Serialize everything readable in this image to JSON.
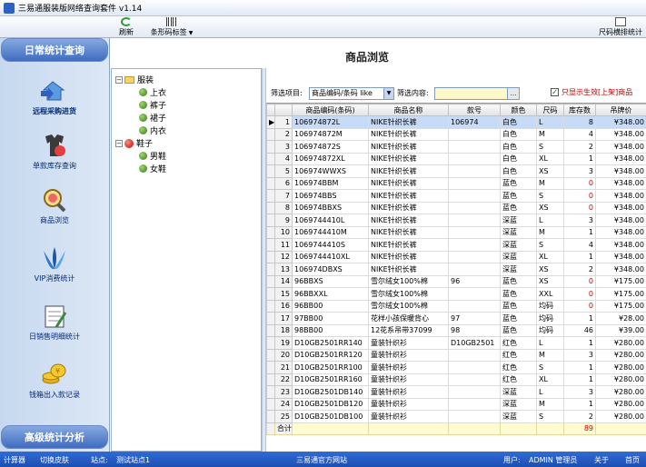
{
  "window": {
    "title": "三易通服装版网络查询套件 v1.14"
  },
  "toolbar": {
    "refresh_label": "刷新",
    "barcode_label": "条形码标签",
    "report_label": "尺码横排统计"
  },
  "sidebar": {
    "header_top": "日常统计查询",
    "header_bottom": "高级统计分析",
    "items": [
      {
        "label": "远程采购进货",
        "icon": "house-arrow-icon"
      },
      {
        "label": "单款库存查询",
        "icon": "clothes-icon"
      },
      {
        "label": "商品浏览",
        "icon": "magnifier-icon"
      },
      {
        "label": "VIP消费统计",
        "icon": "vip-icon"
      },
      {
        "label": "日销售明细统计",
        "icon": "notebook-icon"
      },
      {
        "label": "钱箱出入款记录",
        "icon": "coins-icon"
      }
    ]
  },
  "tree": {
    "root1": "服装",
    "root1_children": [
      "上衣",
      "裤子",
      "裙子",
      "内衣"
    ],
    "root2": "鞋子",
    "root2_children": [
      "男鞋",
      "女鞋"
    ]
  },
  "main": {
    "title": "商品浏览",
    "filter_label": "筛选项目:",
    "filter_value": "商品编码/条码 like",
    "content_label": "筛选内容:",
    "content_value": "",
    "checkbox_label": "只显示生效[上架]商品",
    "checkbox_checked": true
  },
  "grid": {
    "headers": [
      "商品编码(条码)",
      "商品名称",
      "款号",
      "颜色",
      "尺码",
      "库存数",
      "吊牌价"
    ],
    "rows": [
      [
        "106974872L",
        "NIKE针织长裤",
        "106974",
        "白色",
        "L",
        "8",
        "¥348.00"
      ],
      [
        "106974872M",
        "NIKE针织长裤",
        "",
        "白色",
        "M",
        "4",
        "¥348.00"
      ],
      [
        "106974872S",
        "NIKE针织长裤",
        "",
        "白色",
        "S",
        "2",
        "¥348.00"
      ],
      [
        "106974872XL",
        "NIKE针织长裤",
        "",
        "白色",
        "XL",
        "1",
        "¥348.00"
      ],
      [
        "106974WWXS",
        "NIKE针织长裤",
        "",
        "白色",
        "XS",
        "3",
        "¥348.00"
      ],
      [
        "106974BBM",
        "NIKE针织长裤",
        "",
        "蓝色",
        "M",
        "0",
        "¥348.00"
      ],
      [
        "106974BBS",
        "NIKE针织长裤",
        "",
        "蓝色",
        "S",
        "0",
        "¥348.00"
      ],
      [
        "106974BBXS",
        "NIKE针织长裤",
        "",
        "蓝色",
        "XS",
        "0",
        "¥348.00"
      ],
      [
        "1069744410L",
        "NIKE针织长裤",
        "",
        "深蓝",
        "L",
        "3",
        "¥348.00"
      ],
      [
        "1069744410M",
        "NIKE针织长裤",
        "",
        "深蓝",
        "M",
        "1",
        "¥348.00"
      ],
      [
        "1069744410S",
        "NIKE针织长裤",
        "",
        "深蓝",
        "S",
        "4",
        "¥348.00"
      ],
      [
        "1069744410XL",
        "NIKE针织长裤",
        "",
        "深蓝",
        "XL",
        "1",
        "¥348.00"
      ],
      [
        "106974DBXS",
        "NIKE针织长裤",
        "",
        "深蓝",
        "XS",
        "2",
        "¥348.00"
      ],
      [
        "96BBXS",
        "雪尔绒女100%棉",
        "96",
        "蓝色",
        "XS",
        "0",
        "¥175.00"
      ],
      [
        "96BBXXL",
        "雪尔绒女100%棉",
        "",
        "蓝色",
        "XXL",
        "0",
        "¥175.00"
      ],
      [
        "96BB00",
        "雪尔绒女100%棉",
        "",
        "蓝色",
        "均码",
        "0",
        "¥175.00"
      ],
      [
        "97BB00",
        "花样小孩保暖背心",
        "97",
        "蓝色",
        "均码",
        "1",
        "¥28.00"
      ],
      [
        "98BB00",
        "12花系吊带37099",
        "98",
        "蓝色",
        "均码",
        "46",
        "¥39.00"
      ],
      [
        "D10GB2501RR140",
        "童装针织衫",
        "D10GB2501",
        "红色",
        "L",
        "1",
        "¥280.00"
      ],
      [
        "D10GB2501RR120",
        "童装针织衫",
        "",
        "红色",
        "M",
        "3",
        "¥280.00"
      ],
      [
        "D10GB2501RR100",
        "童装针织衫",
        "",
        "红色",
        "S",
        "1",
        "¥280.00"
      ],
      [
        "D10GB2501RR160",
        "童装针织衫",
        "",
        "红色",
        "XL",
        "1",
        "¥280.00"
      ],
      [
        "D10GB2501DB140",
        "童装针织衫",
        "",
        "深蓝",
        "L",
        "3",
        "¥280.00"
      ],
      [
        "D10GB2501DB120",
        "童装针织衫",
        "",
        "深蓝",
        "M",
        "1",
        "¥280.00"
      ],
      [
        "D10GB2501DB100",
        "童装针织衫",
        "",
        "深蓝",
        "S",
        "2",
        "¥280.00"
      ]
    ],
    "total_label": "合计",
    "total_stock": "89"
  },
  "status": {
    "calculator": "计算器",
    "skin": "切换皮肤",
    "site_label": "站点:",
    "site_value": "测试站点1",
    "website": "三易通官方网站",
    "user_label": "用户:",
    "user_value": "ADMIN 管理员",
    "about": "关于",
    "home": "首页"
  }
}
